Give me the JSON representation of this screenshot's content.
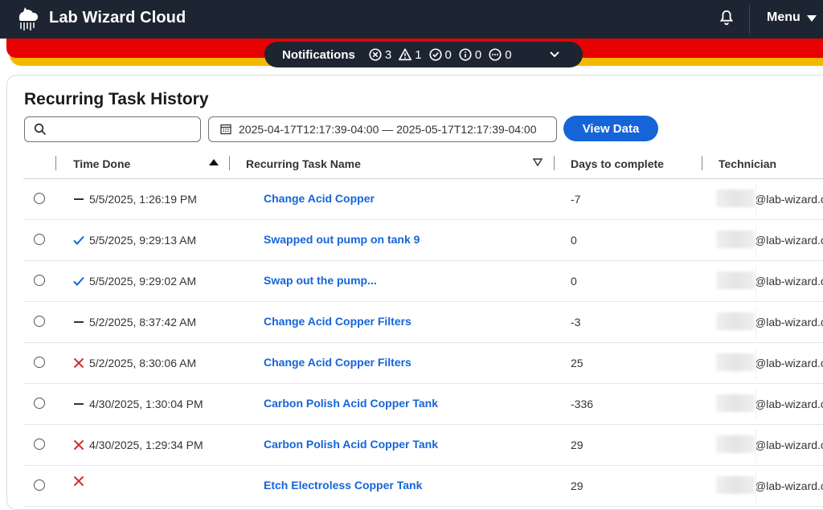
{
  "app": {
    "title": "Lab Wizard Cloud",
    "menu_label": "Menu"
  },
  "notifications": {
    "label": "Notifications",
    "error_count": "3",
    "warning_count": "1",
    "success_count": "0",
    "info_count": "0",
    "other_count": "0"
  },
  "page": {
    "title": "Recurring Task History",
    "search_placeholder": "",
    "date_range": "2025-04-17T12:17:39-04:00 — 2025-05-17T12:17:39-04:00",
    "view_data_label": "View Data"
  },
  "table": {
    "columns": [
      "Time Done",
      "Recurring Task Name",
      "Days to complete",
      "Technician"
    ],
    "sort": {
      "column": "Time Done",
      "direction": "ascending"
    },
    "rows": [
      {
        "status": "pending",
        "time": "5/5/2025, 1:26:19 PM",
        "task": "Change Acid Copper",
        "days": "-7",
        "tech": "@lab-wizard.co"
      },
      {
        "status": "done",
        "time": "5/5/2025, 9:29:13 AM",
        "task": "Swapped out pump on tank 9",
        "days": "0",
        "tech": "@lab-wizard.co"
      },
      {
        "status": "done",
        "time": "5/5/2025, 9:29:02 AM",
        "task": "Swap out the pump...",
        "days": "0",
        "tech": "@lab-wizard.co"
      },
      {
        "status": "pending",
        "time": "5/2/2025, 8:37:42 AM",
        "task": "Change Acid Copper Filters",
        "days": "-3",
        "tech": "@lab-wizard.co"
      },
      {
        "status": "failed",
        "time": "5/2/2025, 8:30:06 AM",
        "task": "Change Acid Copper Filters",
        "days": "25",
        "tech": "@lab-wizard.co"
      },
      {
        "status": "pending",
        "time": "4/30/2025, 1:30:04 PM",
        "task": "Carbon Polish Acid Copper Tank",
        "days": "-336",
        "tech": "@lab-wizard.co"
      },
      {
        "status": "failed",
        "time": "4/30/2025, 1:29:34 PM",
        "task": "Carbon Polish Acid Copper Tank",
        "days": "29",
        "tech": "@lab-wizard.co"
      },
      {
        "status": "failed",
        "time": "",
        "task": "Etch Electroless Copper Tank",
        "days": "29",
        "tech": "@lab-wizard.co"
      }
    ]
  },
  "colors": {
    "topbar": "#1d2532",
    "accent_blue": "#1565d8",
    "stripe_red": "#e60000",
    "stripe_yellow": "#f5b800",
    "done_check": "#1565d8",
    "failed_x": "#d32f2f"
  },
  "icons": {
    "logo": "wizard-cloud-icon",
    "bell": "bell-icon",
    "search": "search-icon",
    "calendar": "calendar-icon"
  }
}
